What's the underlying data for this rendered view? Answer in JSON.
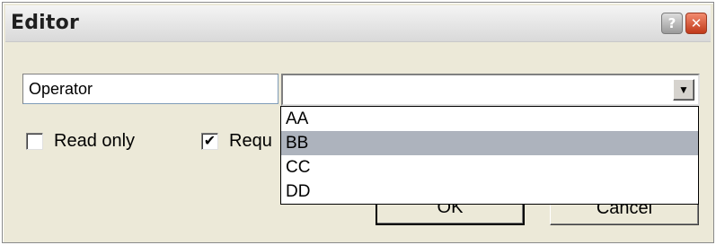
{
  "window": {
    "title": "Editor",
    "help_icon": "?",
    "close_icon": "✕"
  },
  "fields": {
    "name_value": "Operator",
    "combo_value": "",
    "combo_arrow": "▼"
  },
  "checkboxes": {
    "read_only_label": "Read only",
    "read_only_checked": false,
    "required_label": "Requ",
    "required_checked": true,
    "check_glyph": "✔"
  },
  "buttons": {
    "ok_label": "OK",
    "cancel_label": "Cancel"
  },
  "dropdown": {
    "items": [
      "AA",
      "BB",
      "CC",
      "DD"
    ],
    "highlighted": "BB"
  }
}
